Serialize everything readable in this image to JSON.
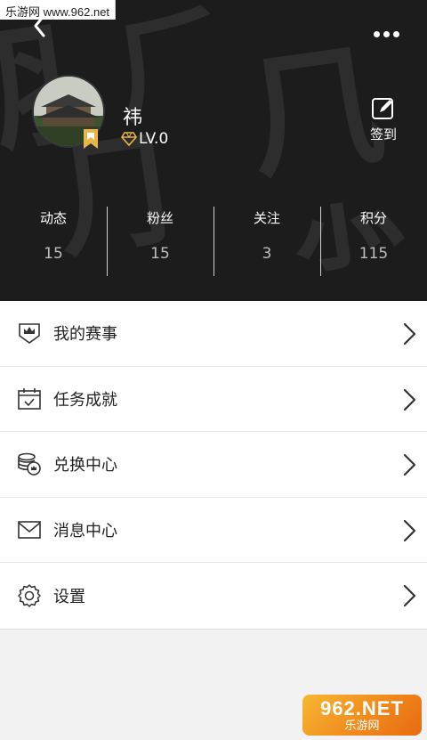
{
  "watermark": {
    "top_text": "乐游网 www.962.net",
    "bottom_main": "962.NET",
    "bottom_sub": "乐游网"
  },
  "colors": {
    "header_bg": "#1c1c1c",
    "accent_gold": "#e8b54a",
    "text_dark": "#222222",
    "page_bg": "#f2f2f2"
  },
  "profile": {
    "name": "祎",
    "level": "LV.0",
    "checkin_label": "签到"
  },
  "stats": [
    {
      "label": "动态",
      "value": "15"
    },
    {
      "label": "粉丝",
      "value": "15"
    },
    {
      "label": "关注",
      "value": "3"
    },
    {
      "label": "积分",
      "value": "115"
    }
  ],
  "menu": [
    {
      "label": "我的赛事",
      "icon": "crown-shield-icon"
    },
    {
      "label": "任务成就",
      "icon": "calendar-check-icon"
    },
    {
      "label": "兑换中心",
      "icon": "coins-icon"
    },
    {
      "label": "消息中心",
      "icon": "mail-icon"
    },
    {
      "label": "设置",
      "icon": "gear-icon"
    }
  ]
}
